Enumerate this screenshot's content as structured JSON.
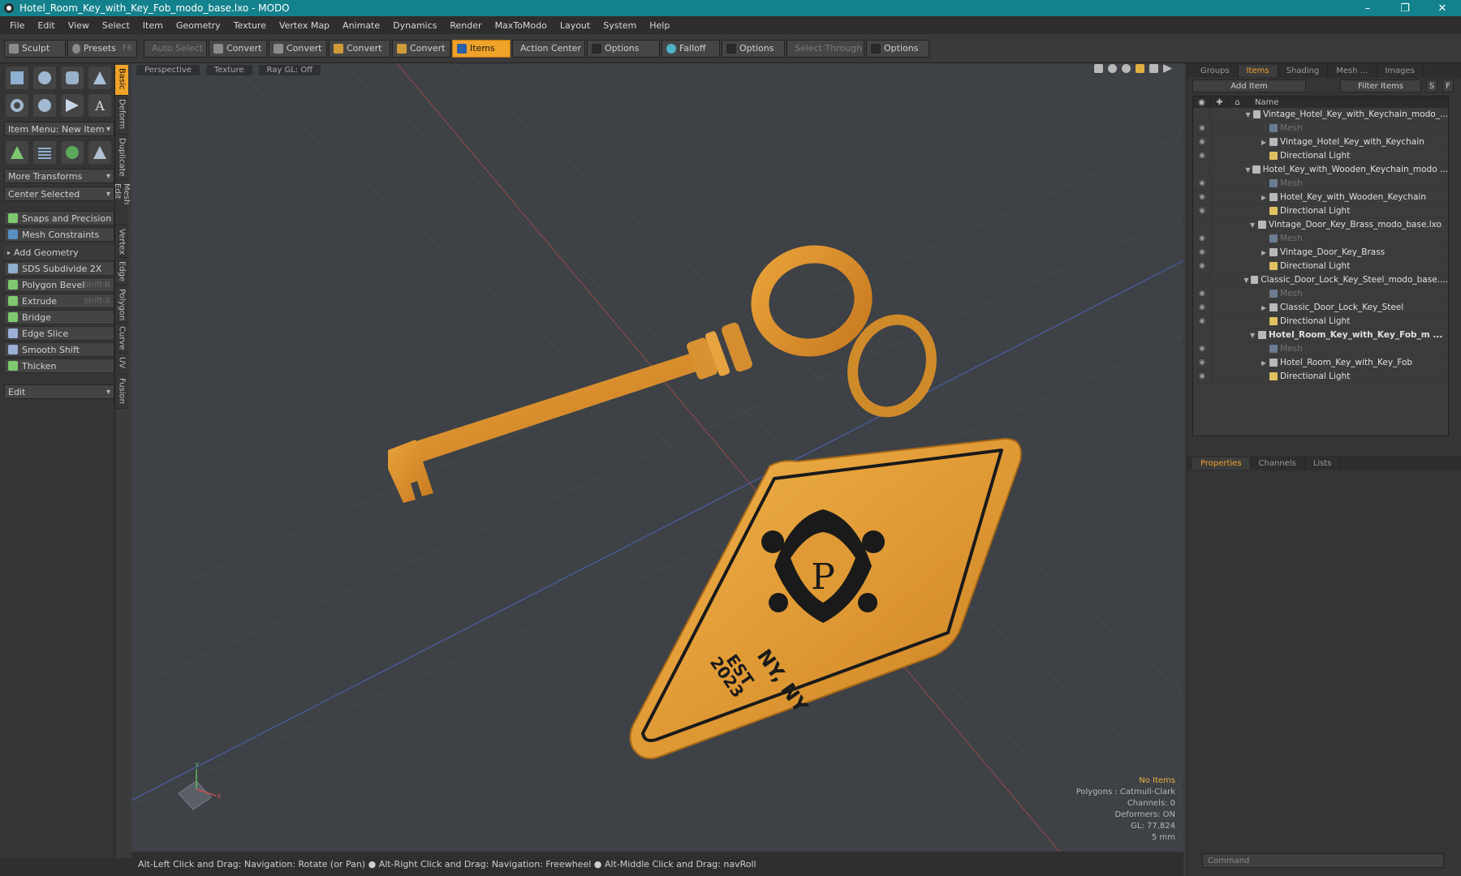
{
  "window": {
    "title": "Hotel_Room_Key_with_Key_Fob_modo_base.lxo - MODO",
    "minimize": "–",
    "maximize": "❐",
    "close": "✕"
  },
  "menu": [
    "File",
    "Edit",
    "View",
    "Select",
    "Item",
    "Geometry",
    "Texture",
    "Vertex Map",
    "Animate",
    "Dynamics",
    "Render",
    "MaxToModo",
    "Layout",
    "System",
    "Help"
  ],
  "toolbar": {
    "sculpt": "Sculpt",
    "presets": "Presets",
    "presets_key": "F6",
    "auto_select": "Auto Select",
    "convert1": "Convert",
    "convert2": "Convert",
    "convert3": "Convert",
    "convert4": "Convert",
    "items": "Items",
    "action_center": "Action Center",
    "options1": "Options",
    "falloff": "Falloff",
    "options2": "Options",
    "select_through": "Select Through",
    "options3": "Options"
  },
  "left": {
    "item_menu": "Item Menu: New Item",
    "more_transforms": "More Transforms",
    "center_selected": "Center Selected",
    "snaps": "Snaps and Precision",
    "mesh_constraints": "Mesh Constraints",
    "add_geometry": "Add Geometry",
    "sds": "SDS Subdivide 2X",
    "polygon_bevel": "Polygon Bevel",
    "polygon_bevel_key": "Shift-B",
    "extrude": "Extrude",
    "extrude_key": "Shift-X",
    "bridge": "Bridge",
    "edge_slice": "Edge Slice",
    "smooth_shift": "Smooth Shift",
    "thicken": "Thicken",
    "edit": "Edit"
  },
  "vtabs": [
    "Basic",
    "Deform",
    "Duplicate",
    "Mesh Edit",
    "Vertex",
    "Edge",
    "Polygon",
    "Curve",
    "UV",
    "Fusion"
  ],
  "viewport": {
    "perspective": "Perspective",
    "texture": "Texture",
    "raygl": "Ray GL: Off",
    "fob_text1": "NY, NY",
    "fob_text2": "EST",
    "fob_text3": "2023",
    "stats": {
      "no_items": "No Items",
      "polygons": "Polygons : Catmull-Clark",
      "channels": "Channels: 0",
      "deformers": "Deformers: ON",
      "gl": "GL: 77,824",
      "scale": "5 mm"
    },
    "axis_y": "Y",
    "axis_x": "X"
  },
  "status": "Alt-Left Click and Drag: Navigation: Rotate (or Pan) ● Alt-Right Click and Drag: Navigation: Freewheel ● Alt-Middle Click and Drag: navRoll",
  "right": {
    "tabs": [
      "Groups",
      "Items",
      "Shading",
      "Mesh ...",
      "Images"
    ],
    "add_item": "Add Item",
    "filter_items": "Filter Items",
    "s_btn": "S",
    "f_btn": "F",
    "name_col": "Name",
    "tree": [
      {
        "label": "Vintage_Hotel_Key_with_Keychain_modo_...",
        "level": 0,
        "kind": "scene"
      },
      {
        "label": "Mesh",
        "level": 1,
        "kind": "mesh"
      },
      {
        "label": "Vintage_Hotel_Key_with_Keychain",
        "level": 1,
        "kind": "item"
      },
      {
        "label": "Directional Light",
        "level": 1,
        "kind": "light"
      },
      {
        "label": "Hotel_Key_with_Wooden_Keychain_modo ...",
        "level": 0,
        "kind": "scene"
      },
      {
        "label": "Mesh",
        "level": 1,
        "kind": "mesh"
      },
      {
        "label": "Hotel_Key_with_Wooden_Keychain",
        "level": 1,
        "kind": "item"
      },
      {
        "label": "Directional Light",
        "level": 1,
        "kind": "light"
      },
      {
        "label": "Vintage_Door_Key_Brass_modo_base.lxo",
        "level": 0,
        "kind": "scene"
      },
      {
        "label": "Mesh",
        "level": 1,
        "kind": "mesh"
      },
      {
        "label": "Vintage_Door_Key_Brass",
        "level": 1,
        "kind": "item"
      },
      {
        "label": "Directional Light",
        "level": 1,
        "kind": "light"
      },
      {
        "label": "Classic_Door_Lock_Key_Steel_modo_base....",
        "level": 0,
        "kind": "scene"
      },
      {
        "label": "Mesh",
        "level": 1,
        "kind": "mesh"
      },
      {
        "label": "Classic_Door_Lock_Key_Steel",
        "level": 1,
        "kind": "item"
      },
      {
        "label": "Directional Light",
        "level": 1,
        "kind": "light"
      },
      {
        "label": "Hotel_Room_Key_with_Key_Fob_m ...",
        "level": 0,
        "kind": "scene",
        "bold": true
      },
      {
        "label": "Mesh",
        "level": 1,
        "kind": "mesh"
      },
      {
        "label": "Hotel_Room_Key_with_Key_Fob",
        "level": 1,
        "kind": "item"
      },
      {
        "label": "Directional Light",
        "level": 1,
        "kind": "light"
      }
    ],
    "prop_tabs": [
      "Properties",
      "Channels",
      "Lists"
    ],
    "command": "Command"
  },
  "colors": {
    "accent": "#f0a329",
    "titlebar": "#14828c",
    "brass": "#e0a040"
  }
}
